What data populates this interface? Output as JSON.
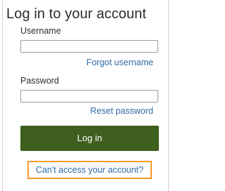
{
  "form": {
    "title": "Log in to your account",
    "username_label": "Username",
    "username_value": "",
    "forgot_username_link": "Forgot username",
    "password_label": "Password",
    "password_value": "",
    "reset_password_link": "Reset password",
    "login_button": "Log in",
    "cant_access_link": "Can't access your account?"
  },
  "colors": {
    "primary_button": "#3f5f1f",
    "link": "#2e6aa5",
    "highlight_border": "#f59a2a",
    "text": "#2b2b2b",
    "field_border": "#9a9a9a"
  }
}
